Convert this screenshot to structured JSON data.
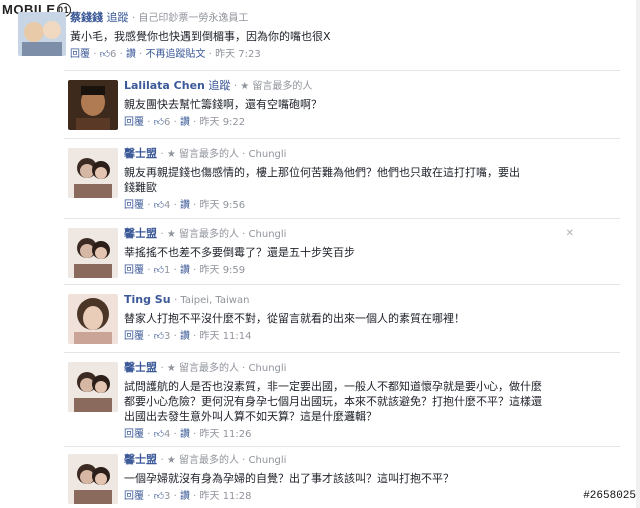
{
  "watermark": {
    "brand": "MOBILE",
    "badge": "01"
  },
  "post_id": "#2658025",
  "comments": [
    {
      "name": "蔡錢錢",
      "follow": "追蹤",
      "meta": "· 自己印鈔票一勞永逸員工",
      "text": "黃小毛，我感覺你也快遇到倒楣事，因為你的嘴也很X",
      "reply": "回覆",
      "likes": "6",
      "like": "讚",
      "extra": "不再追蹤貼文",
      "time": "昨天 7:23",
      "avatar_colors": [
        "#c7d5e5",
        "#e8c9a8"
      ]
    },
    {
      "name": "Lalilata Chen",
      "follow": "追蹤",
      "meta": "· ★ 留言最多的人",
      "text": "親友團快去幫忙籌錢啊，還有空嘴砲啊？",
      "reply": "回覆",
      "likes": "6",
      "like": "讚",
      "time": "昨天 9:22",
      "avatar_colors": [
        "#2b1e14",
        "#b07a52"
      ]
    },
    {
      "name": "馨士盟",
      "follow": "",
      "meta": "· ★ 留言最多的人 · Chungli",
      "text": "親友再親提錢也傷感情的，樓上那位何苦難為他們？他們也只敢在這打打嘴，要出錢難歐",
      "reply": "回覆",
      "likes": "4",
      "like": "讚",
      "time": "昨天 9:56",
      "avatar_colors": [
        "#3a2a22",
        "#d6b7a4"
      ]
    },
    {
      "name": "馨士盟",
      "follow": "",
      "meta": "· ★ 留言最多的人 · Chungli",
      "text": "莘搖搖不也差不多要倒霉了？還是五十步笑百步",
      "reply": "回覆",
      "likes": "1",
      "like": "讚",
      "time": "昨天 9:59",
      "avatar_colors": [
        "#3a2a22",
        "#d6b7a4"
      ]
    },
    {
      "name": "Ting Su",
      "follow": "",
      "meta": "· Taipei, Taiwan",
      "text": "替家人打抱不平沒什麼不對，從留言就看的出來一個人的素質在哪裡！",
      "reply": "回覆",
      "likes": "3",
      "like": "讚",
      "time": "昨天 11:14",
      "avatar_colors": [
        "#4a3526",
        "#e9cdb9"
      ]
    },
    {
      "name": "馨士盟",
      "follow": "",
      "meta": "· ★ 留言最多的人 · Chungli",
      "text": "試問護航的人是否也沒素質，非一定要出國，一般人不都知道懷孕就是要小心，做什麼都要小心危險？更何況有身孕七個月出國玩，本來不就該避免？打抱什麼不平？這樣還出國出去發生意外叫人算不如天算？這是什麼邏輯？",
      "reply": "回覆",
      "likes": "4",
      "like": "讚",
      "time": "昨天 11:26",
      "avatar_colors": [
        "#3a2a22",
        "#d6b7a4"
      ]
    },
    {
      "name": "馨士盟",
      "follow": "",
      "meta": "· ★ 留言最多的人 · Chungli",
      "text": "一個孕婦就沒有身為孕婦的自覺？出了事才該該叫？這叫打抱不平？",
      "reply": "回覆",
      "likes": "3",
      "like": "讚",
      "time": "昨天 11:28",
      "avatar_colors": [
        "#3a2a22",
        "#d6b7a4"
      ]
    }
  ]
}
